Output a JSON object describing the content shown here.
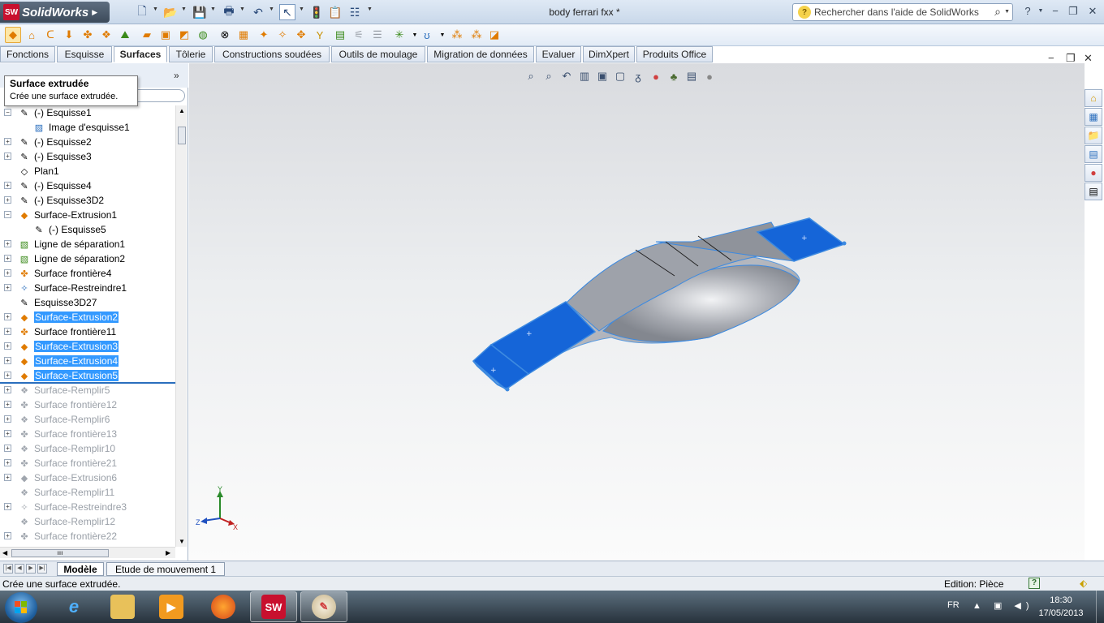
{
  "app": {
    "logo_text": "SolidWorks",
    "logo_badge": "SW",
    "document_title": "body ferrari fxx *"
  },
  "search": {
    "placeholder": "Rechercher dans l'aide de SolidWorks"
  },
  "tabs": [
    "Fonctions",
    "Esquisse",
    "Surfaces",
    "Tôlerie",
    "Constructions soudées",
    "Outils de moulage",
    "Migration de données",
    "Evaluer",
    "DimXpert",
    "Produits Office"
  ],
  "active_tab": "Surfaces",
  "tooltip": {
    "title": "Surface extrudée",
    "description": "Crée une surface extrudée."
  },
  "tree": [
    {
      "label": "(-) Esquisse1",
      "icon": "sketch-icon",
      "expander": "minus",
      "indent": 0,
      "state": "normal"
    },
    {
      "label": "Image d'esquisse1",
      "icon": "sketch-picture-icon",
      "expander": "none",
      "indent": 1,
      "state": "normal"
    },
    {
      "label": "(-) Esquisse2",
      "icon": "sketch-icon",
      "expander": "plus",
      "indent": 0,
      "state": "normal"
    },
    {
      "label": "(-) Esquisse3",
      "icon": "sketch-icon",
      "expander": "plus",
      "indent": 0,
      "state": "normal"
    },
    {
      "label": "Plan1",
      "icon": "plane-icon",
      "expander": "none",
      "indent": 0,
      "state": "normal"
    },
    {
      "label": "(-) Esquisse4",
      "icon": "sketch-icon",
      "expander": "plus",
      "indent": 0,
      "state": "normal"
    },
    {
      "label": "(-) Esquisse3D2",
      "icon": "sketch-3d-icon",
      "expander": "plus",
      "indent": 0,
      "state": "normal"
    },
    {
      "label": "Surface-Extrusion1",
      "icon": "surface-extrude-icon",
      "expander": "minus",
      "indent": 0,
      "state": "normal"
    },
    {
      "label": "(-) Esquisse5",
      "icon": "sketch-icon",
      "expander": "none",
      "indent": 1,
      "state": "normal"
    },
    {
      "label": "Ligne de séparation1",
      "icon": "split-line-icon",
      "expander": "plus",
      "indent": 0,
      "state": "normal"
    },
    {
      "label": "Ligne de séparation2",
      "icon": "split-line-icon",
      "expander": "plus",
      "indent": 0,
      "state": "normal"
    },
    {
      "label": "Surface frontière4",
      "icon": "boundary-surface-icon",
      "expander": "plus",
      "indent": 0,
      "state": "normal"
    },
    {
      "label": "Surface-Restreindre1",
      "icon": "trim-surface-icon",
      "expander": "plus",
      "indent": 0,
      "state": "normal"
    },
    {
      "label": "Esquisse3D27",
      "icon": "sketch-3d-icon",
      "expander": "none",
      "indent": 0,
      "state": "normal"
    },
    {
      "label": "Surface-Extrusion2",
      "icon": "surface-extrude-icon",
      "expander": "plus",
      "indent": 0,
      "state": "selected"
    },
    {
      "label": "Surface frontière11",
      "icon": "boundary-surface-icon",
      "expander": "plus",
      "indent": 0,
      "state": "normal"
    },
    {
      "label": "Surface-Extrusion3",
      "icon": "surface-extrude-icon",
      "expander": "plus",
      "indent": 0,
      "state": "selected"
    },
    {
      "label": "Surface-Extrusion4",
      "icon": "surface-extrude-icon",
      "expander": "plus",
      "indent": 0,
      "state": "selected"
    },
    {
      "label": "Surface-Extrusion5",
      "icon": "surface-extrude-icon",
      "expander": "plus",
      "indent": 0,
      "state": "selected"
    },
    {
      "label": "Surface-Remplir5",
      "icon": "fill-surface-icon",
      "expander": "plus",
      "indent": 0,
      "state": "suppressed"
    },
    {
      "label": "Surface frontière12",
      "icon": "boundary-surface-icon",
      "expander": "plus",
      "indent": 0,
      "state": "suppressed"
    },
    {
      "label": "Surface-Remplir6",
      "icon": "fill-surface-icon",
      "expander": "plus",
      "indent": 0,
      "state": "suppressed"
    },
    {
      "label": "Surface frontière13",
      "icon": "boundary-surface-icon",
      "expander": "plus",
      "indent": 0,
      "state": "suppressed"
    },
    {
      "label": "Surface-Remplir10",
      "icon": "fill-surface-icon",
      "expander": "plus",
      "indent": 0,
      "state": "suppressed"
    },
    {
      "label": "Surface frontière21",
      "icon": "boundary-surface-icon",
      "expander": "plus",
      "indent": 0,
      "state": "suppressed"
    },
    {
      "label": "Surface-Extrusion6",
      "icon": "surface-extrude-icon",
      "expander": "plus",
      "indent": 0,
      "state": "suppressed"
    },
    {
      "label": "Surface-Remplir11",
      "icon": "fill-surface-icon",
      "expander": "none",
      "indent": 0,
      "state": "suppressed"
    },
    {
      "label": "Surface-Restreindre3",
      "icon": "trim-surface-icon",
      "expander": "plus",
      "indent": 0,
      "state": "suppressed"
    },
    {
      "label": "Surface-Remplir12",
      "icon": "fill-surface-icon",
      "expander": "none",
      "indent": 0,
      "state": "suppressed"
    },
    {
      "label": "Surface frontière22",
      "icon": "boundary-surface-icon",
      "expander": "plus",
      "indent": 0,
      "state": "suppressed"
    }
  ],
  "bottom_tabs": [
    "Modèle",
    "Etude de mouvement 1"
  ],
  "triad": {
    "y": "Y",
    "z": "Z",
    "x": "X"
  },
  "status": {
    "message": "Crée une surface extrudée.",
    "edition": "Edition: Pièce",
    "help": "?"
  },
  "taskbar": {
    "language": "FR",
    "time": "18:30",
    "date": "17/05/2013",
    "sw_badge": "SW"
  },
  "colors": {
    "selection": "#3399ff",
    "surface_selected": "#1565d8",
    "model_gray": "#9a9ea6",
    "accent": "#c8102e"
  }
}
